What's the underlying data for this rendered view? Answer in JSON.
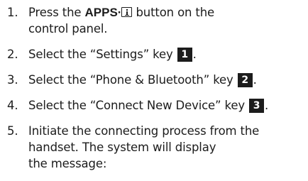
{
  "steps": [
    {
      "number": "1.",
      "lines": [
        {
          "before": "Press the ",
          "button_name": "APPS·",
          "after": "button on the"
        },
        "control panel."
      ]
    },
    {
      "number": "2.",
      "text": "Select the “Settings” key",
      "badge": "1",
      "end": "."
    },
    {
      "number": "3.",
      "text": "Select the “Phone & Bluetooth” key",
      "badge": "2",
      "end": "."
    },
    {
      "number": "4.",
      "text": "Select the “Connect New Device” key",
      "badge": "3",
      "end": "."
    },
    {
      "number": "5.",
      "lines": [
        "Initiate the connecting process from the",
        "handset. The system will display",
        "the message:"
      ]
    }
  ],
  "icons": {
    "info_button_icon": "info-icon"
  },
  "colors": {
    "text": "#1c1c1c",
    "badge_background": "#1c1c1c",
    "badge_text": "#ffffff",
    "page_background": "#ffffff"
  }
}
